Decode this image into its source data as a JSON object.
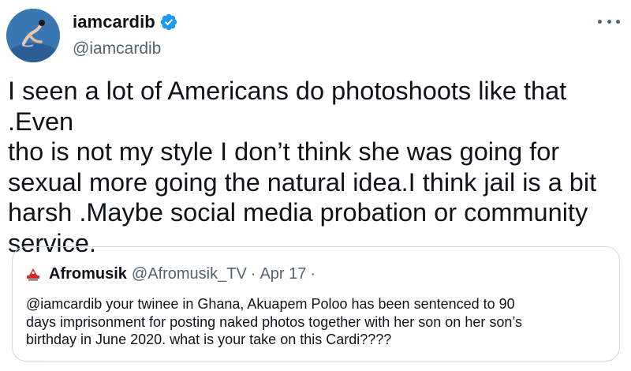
{
  "tweet": {
    "author": {
      "display_name": "iamcardib",
      "handle": "@iamcardib",
      "verified": true,
      "avatar_icon": "profile-avatar"
    },
    "more_icon": "more-options-icon",
    "text_lines": [
      "I seen a lot of Americans do photoshoots like that .Even",
      "tho is not my style I don’t think she was going for",
      "sexual more going the natural idea.I think jail is a bit",
      "harsh .Maybe social media probation or community",
      "service."
    ]
  },
  "quoted_tweet": {
    "display_name": "Afromusik",
    "handle": "@Afromusik_TV",
    "separator": "·",
    "date": "Apr 17",
    "trailing_separator": "·",
    "text_lines": [
      "@iamcardib your twinee in Ghana, Akuapem Poloo has been sentenced to 90",
      "days imprisonment for posting naked photos together with her son on her son’s",
      "birthday in June 2020.  what is your take on this Cardi????"
    ]
  },
  "colors": {
    "primary_text": "#0f1419",
    "secondary_text": "#536471",
    "verified_blue": "#1d9bf0",
    "border": "#cfd9de",
    "afromusik_red": "#d9262c"
  }
}
